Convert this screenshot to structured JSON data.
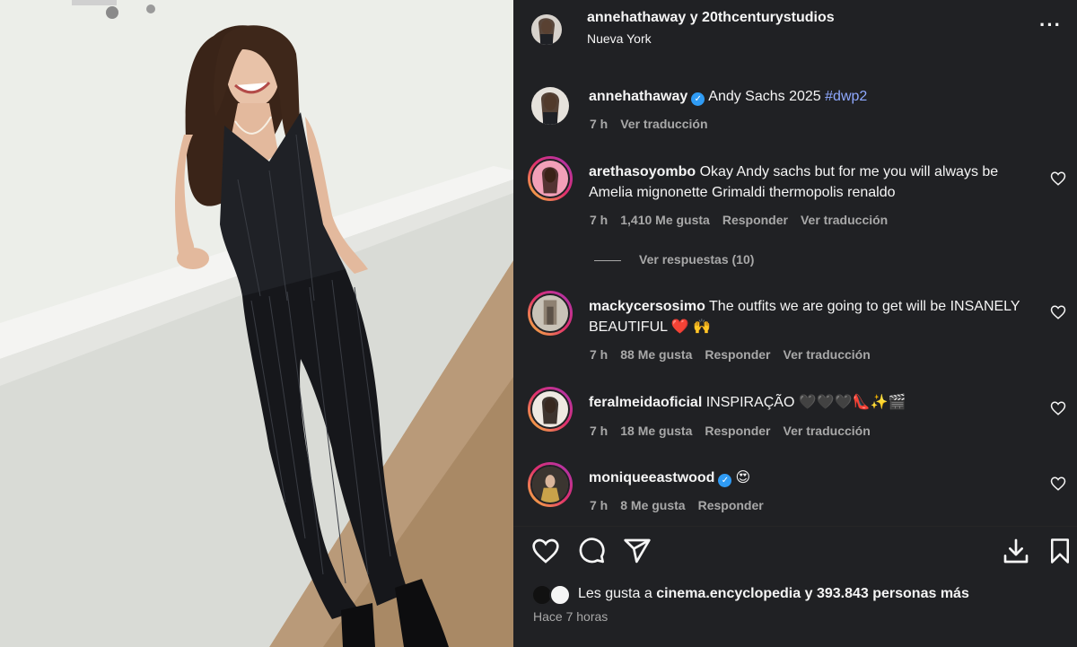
{
  "header": {
    "title": "annehathaway y 20thcenturystudios",
    "location": "Nueva York",
    "more_icon": "more-horizontal-icon"
  },
  "caption": {
    "username": "annehathaway",
    "text": "Andy Sachs 2025",
    "hashtag": "#dwp2",
    "time": "7 h",
    "translate": "Ver traducción"
  },
  "comments": [
    {
      "username": "arethasoyombo",
      "text": "Okay Andy sachs but for me you will always be Amelia mignonette Grimaldi thermopolis renaldo",
      "time": "7 h",
      "likes": "1,410 Me gusta",
      "reply": "Responder",
      "translate": "Ver traducción",
      "view_replies": "Ver respuestas (10)"
    },
    {
      "username": "mackycersosimo",
      "text": "The outfits we are going to get will be INSANELY BEAUTIFUL",
      "emoji": "❤️ 🙌",
      "time": "7 h",
      "likes": "88 Me gusta",
      "reply": "Responder",
      "translate": "Ver traducción"
    },
    {
      "username": "feralmeidaoficial",
      "text": "INSPIRAÇÃO",
      "emoji": "🖤🖤🖤👠✨🎬",
      "time": "7 h",
      "likes": "18 Me gusta",
      "reply": "Responder",
      "translate": "Ver traducción"
    },
    {
      "username": "moniqueeastwood",
      "emoji": "😍",
      "time": "7 h",
      "likes": "8 Me gusta",
      "reply": "Responder"
    }
  ],
  "actions": {
    "icons": [
      "heart-icon",
      "comment-icon",
      "share-icon",
      "download-icon",
      "bookmark-icon"
    ]
  },
  "likes": {
    "prefix": "Les gusta a",
    "user": "cinema.encyclopedia",
    "suffix": "y 393.843 personas más"
  },
  "posted": "Hace 7 horas",
  "colors": {
    "panel_bg": "#202124",
    "text": "#f5f5f5",
    "muted": "#a8a8a8",
    "hashtag": "#8fa9ff",
    "verified": "#2f9bf4"
  }
}
